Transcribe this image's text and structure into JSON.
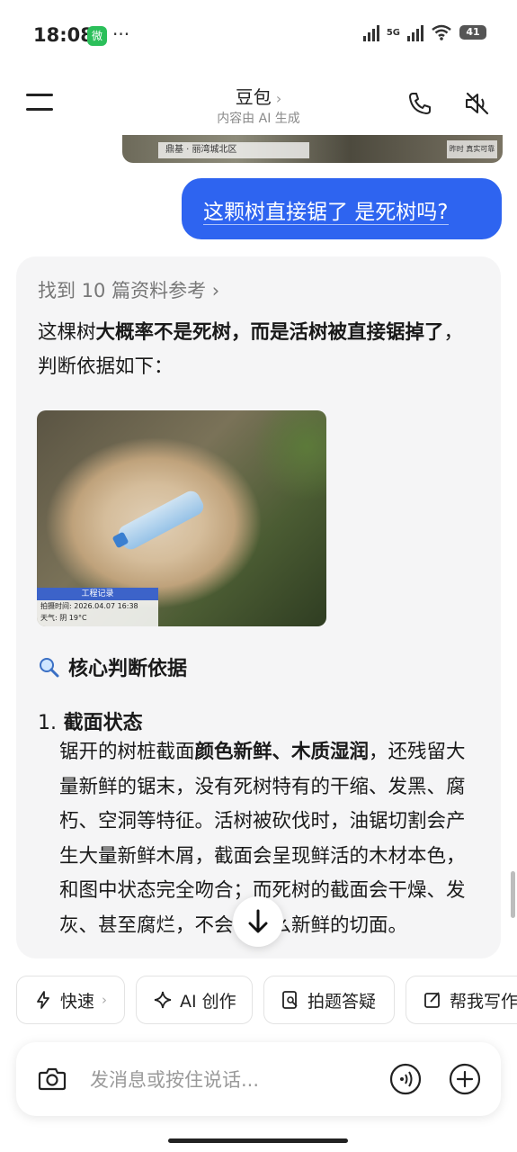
{
  "status_bar": {
    "time": "18:08",
    "wechat_badge": "微",
    "more": "···",
    "network": "5G",
    "battery": "41"
  },
  "header": {
    "title": "豆包",
    "subtitle": "内容由 AI 生成"
  },
  "previous_image": {
    "caption_left": "鼎基 · 丽湾城北区",
    "caption_right": "昨时 真实可靠"
  },
  "user_message": "这颗树直接锯了 是死树吗?",
  "answer": {
    "references": "找到 10 篇资料参考",
    "intro_prefix": "这棵树",
    "intro_bold1": "大概率不是死树，而是活树被直接锯掉了",
    "intro_suffix": "，判断依据如下：",
    "photo": {
      "tag": "工程记录",
      "time_line": "拍摄时间: 2026.04.07 16:38",
      "weather_line": "天气: 阴 19°C"
    },
    "section_title": "核心判断依据",
    "item1_num": "1.",
    "item1_title": "截面状态",
    "item1_pre": "锯开的树桩截面",
    "item1_bold": "颜色新鲜、木质湿润",
    "item1_rest": "，还残留大量新鲜的锯末，没有死树特有的干缩、发黑、腐朽、空洞等特征。活树被砍伐时，油锯切割会产生大量新鲜木屑，截面会呈现鲜活的木材本色，和图中状态完全吻合；而死树的截面会干燥、发灰、甚至腐烂，不会有这么新鲜的切面。"
  },
  "quick_actions": [
    {
      "label": "快速",
      "icon": "lightning-icon"
    },
    {
      "label": "AI 创作",
      "icon": "sparkle-icon"
    },
    {
      "label": "拍题答疑",
      "icon": "photo-search-icon"
    },
    {
      "label": "帮我写作",
      "icon": "edit-icon"
    }
  ],
  "input": {
    "placeholder": "发消息或按住说话..."
  }
}
